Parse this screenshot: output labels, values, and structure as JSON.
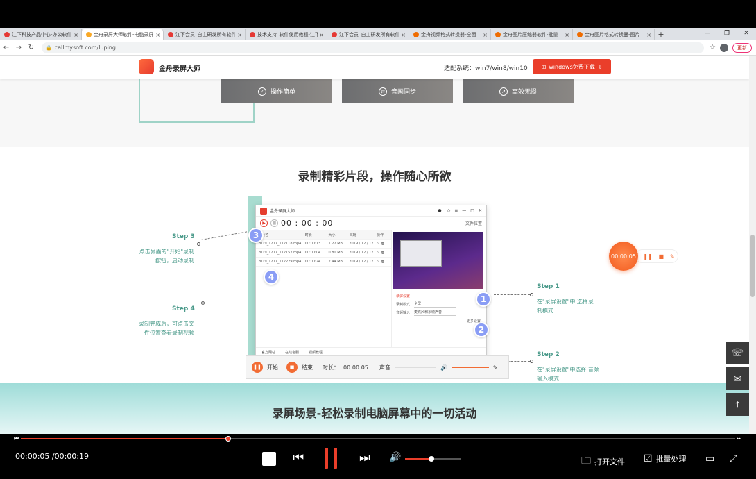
{
  "browser": {
    "tabs": [
      {
        "label": "江下科技产品中心-办公软件",
        "favicon_color": "#e53935",
        "active": false
      },
      {
        "label": "金舟录屏大师软件-电脑录屏",
        "favicon_color": "#f9a825",
        "active": true
      },
      {
        "label": "江下会员_自主研发所有软件",
        "favicon_color": "#e53935",
        "active": false
      },
      {
        "label": "技术支持_软件使用教程-江下",
        "favicon_color": "#e53935",
        "active": false
      },
      {
        "label": "江下会员_自主研发所有软件",
        "favicon_color": "#e53935",
        "active": false
      },
      {
        "label": "金舟视频格式转换器-全面",
        "favicon_color": "#ef6c00",
        "active": false
      },
      {
        "label": "金舟图片压缩器软件-批量",
        "favicon_color": "#ef6c00",
        "active": false
      },
      {
        "label": "金舟图片格式转换器-图片",
        "favicon_color": "#ef6c00",
        "active": false
      }
    ],
    "new_tab": "+",
    "url": "callmysoft.com/luping",
    "update_label": "更新"
  },
  "site": {
    "logo_text": "金舟录屏大师",
    "sys_text": "适配系统：win7/win8/win10",
    "download_label": "windows免费下载"
  },
  "features": [
    {
      "icon": "check-icon",
      "label": "操作简单"
    },
    {
      "icon": "sync-icon",
      "label": "音画同步"
    },
    {
      "icon": "hd-icon",
      "label": "高效无损"
    }
  ],
  "section": {
    "title": "录制精彩片段，操作随心所欲",
    "teal_title": "录屏场景-轻松录制电脑屏幕中的一切活动"
  },
  "steps": {
    "s1": {
      "title": "Step 1",
      "desc": "在\"录屏设置\"中 选择录制模式"
    },
    "s2": {
      "title": "Step 2",
      "desc": "在\"录屏设置\"中选择 音频输入模式"
    },
    "s3": {
      "title": "Step 3",
      "desc": "点击界面的\"开始\"录制按钮，启动录制"
    },
    "s4": {
      "title": "Step 4",
      "desc": "录制完成后，可点击文件位置查看录制视频"
    }
  },
  "app": {
    "title": "金舟录屏大师",
    "timer": "00 : 00 : 00",
    "files_header": [
      "视频名",
      "时长",
      "大小",
      "日期",
      "操作"
    ],
    "files": [
      [
        "2019_1217_112118.mp4",
        "00:00:13",
        "1.27 MB",
        "2019 / 12 / 17"
      ],
      [
        "2019_1217_112157.mp4",
        "00:00:04",
        "0.80 MB",
        "2019 / 12 / 17"
      ],
      [
        "2019_1217_112229.mp4",
        "00:00:24",
        "2.44 MB",
        "2019 / 12 / 17"
      ]
    ],
    "settings_title": "录屏设置",
    "mode_label": "录制模式",
    "mode_value": "全屏",
    "audio_label": "音频输入",
    "audio_value": "麦克风和系统声音",
    "more_label": "更多设置",
    "bottom_items": [
      "官方网站",
      "在线客服",
      "视频教程"
    ],
    "file_loc": "文件位置"
  },
  "recbar": {
    "start": "开始",
    "stop": "结束",
    "duration_label": "时长：",
    "duration": "00:00:05",
    "sound_label": "声音"
  },
  "floating": {
    "time": "00:00:05"
  },
  "player": {
    "time": "00:00:05 /00:00:19",
    "progress": 0.29,
    "volume": 0.47,
    "open_file": "打开文件",
    "batch": "批量处理"
  },
  "colors": {
    "accent": "#ea3e2a",
    "teal": "#4a9a8a",
    "step_badge": "#8a9df5"
  }
}
